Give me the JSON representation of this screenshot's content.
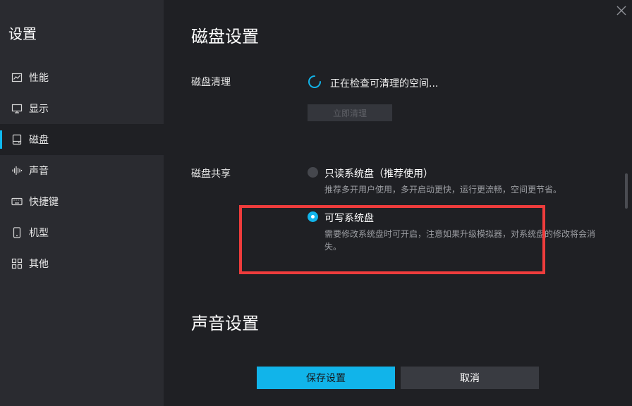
{
  "sidebar": {
    "title": "设置",
    "items": [
      {
        "label": "性能",
        "icon": "chart-line-icon"
      },
      {
        "label": "显示",
        "icon": "monitor-icon"
      },
      {
        "label": "磁盘",
        "icon": "disk-icon",
        "active": true
      },
      {
        "label": "声音",
        "icon": "sound-wave-icon"
      },
      {
        "label": "快捷键",
        "icon": "keyboard-icon"
      },
      {
        "label": "机型",
        "icon": "phone-icon"
      },
      {
        "label": "其他",
        "icon": "grid-icon"
      }
    ]
  },
  "disk_settings": {
    "title": "磁盘设置",
    "cleanup": {
      "label": "磁盘清理",
      "status": "正在检查可清理的空间...",
      "button": "立即清理"
    },
    "sharing": {
      "label": "磁盘共享",
      "options": [
        {
          "label": "只读系统盘（推荐使用）",
          "desc": "推荐多开用户使用，多开启动更快，运行更流畅，空间更节省。",
          "selected": false
        },
        {
          "label": "可写系统盘",
          "desc_line1": "需要修改系统盘时可开启，注意如果升级模拟器，对系统盘的修改将会消",
          "desc_line2": "失。",
          "selected": true
        }
      ]
    }
  },
  "sound_settings": {
    "title": "声音设置"
  },
  "footer": {
    "save": "保存设置",
    "cancel": "取消"
  },
  "colors": {
    "accent": "#11b4ea",
    "highlight": "#ee3c3c",
    "background": "#1f2024",
    "sidebar": "#2a2b30"
  }
}
